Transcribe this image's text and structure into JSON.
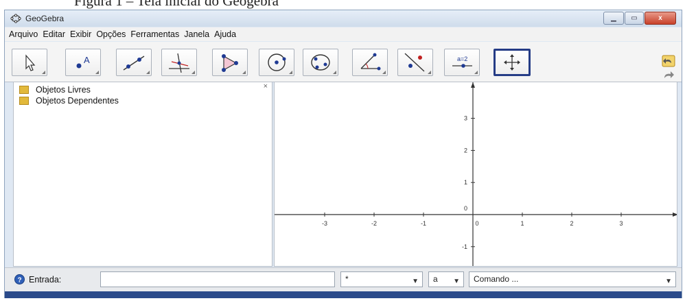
{
  "caption": "Figura 1 – Tela inicial do Geogebra",
  "window": {
    "title": "GeoGebra",
    "controls": {
      "minimize": "",
      "maximize": "",
      "close": "x"
    }
  },
  "menu": [
    "Arquivo",
    "Editar",
    "Exibir",
    "Opções",
    "Ferramentas",
    "Janela",
    "Ajuda"
  ],
  "toolbar": {
    "tools": [
      {
        "name": "move-tool",
        "icon": "pointer-arrow-icon"
      },
      {
        "name": "new-point-tool",
        "icon": "point-icon"
      },
      {
        "name": "line-tool",
        "icon": "line-through-points-icon"
      },
      {
        "name": "perpendicular-line-tool",
        "icon": "perpendicular-line-icon"
      },
      {
        "name": "polygon-tool",
        "icon": "polygon-icon"
      },
      {
        "name": "circle-tool",
        "icon": "circle-center-point-icon"
      },
      {
        "name": "conic-tool",
        "icon": "ellipse-icon"
      },
      {
        "name": "angle-tool",
        "icon": "angle-icon"
      },
      {
        "name": "reflect-tool",
        "icon": "reflect-about-line-icon"
      },
      {
        "name": "slider-tool",
        "icon": "slider-icon"
      },
      {
        "name": "move-graphics-view-tool",
        "icon": "move-view-icon"
      }
    ],
    "slider_label": "a=2",
    "active_tool": "move-graphics-view-tool"
  },
  "algebra": {
    "items": [
      "Objetos Livres",
      "Objetos Dependentes"
    ],
    "close_label": "×"
  },
  "graphics": {
    "x_ticks": [
      "-3",
      "-2",
      "-1",
      "0",
      "1",
      "2",
      "3"
    ],
    "y_ticks": [
      "3",
      "2",
      "1",
      "0",
      "-1"
    ]
  },
  "input_bar": {
    "label": "Entrada:",
    "value": "",
    "symbol_combo": "*",
    "greek_combo": "a",
    "command_combo": "Comando ..."
  },
  "colors": {
    "active_border": "#253c86",
    "window_border": "#8ea3bd",
    "folder": "#e2b93b"
  }
}
